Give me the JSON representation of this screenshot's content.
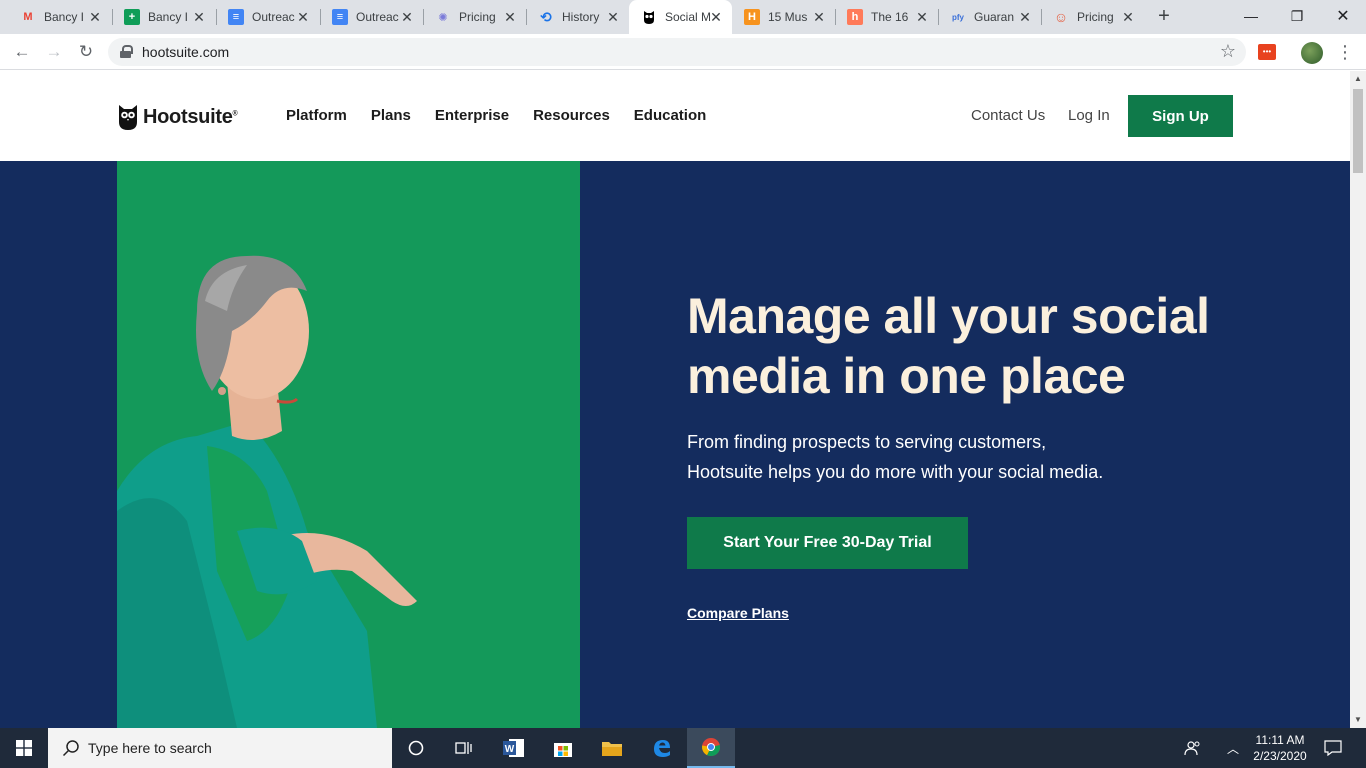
{
  "browser": {
    "tabs": [
      {
        "title": "Bancy I",
        "favicon": "gmail-icon",
        "fav_color": "#ea4335",
        "fav_glyph": "M"
      },
      {
        "title": "Bancy I",
        "favicon": "sheets-icon",
        "fav_color": "#0f9d58",
        "fav_glyph": "+"
      },
      {
        "title": "Outreac",
        "favicon": "docs-icon",
        "fav_color": "#4285f4",
        "fav_glyph": "≡"
      },
      {
        "title": "Outreac",
        "favicon": "docs-icon",
        "fav_color": "#4285f4",
        "fav_glyph": "≡"
      },
      {
        "title": "Pricing",
        "favicon": "sprout-icon",
        "fav_color": "#7b7bd9",
        "fav_glyph": "✺"
      },
      {
        "title": "History",
        "favicon": "history-icon",
        "fav_color": "#1a73e8",
        "fav_glyph": "⟲"
      },
      {
        "title": "Social M",
        "favicon": "hootsuite-owl-icon",
        "fav_color": "#000000",
        "fav_glyph": "◆"
      },
      {
        "title": "15 Mus",
        "favicon": "orange-h-icon",
        "fav_color": "#f7931e",
        "fav_glyph": "H"
      },
      {
        "title": "The 16",
        "favicon": "hubspot-icon",
        "fav_color": "#ff7a59",
        "fav_glyph": "h"
      },
      {
        "title": "Guaran",
        "favicon": "pfy-icon",
        "fav_color": "#3a6fd8",
        "fav_glyph": "pfy"
      },
      {
        "title": "Pricing",
        "favicon": "smiley-icon",
        "fav_color": "#e55e40",
        "fav_glyph": "☺"
      }
    ],
    "active_tab_index": 6,
    "url": "hootsuite.com"
  },
  "site": {
    "logo_text": "Hootsuite",
    "logo_mark": "®",
    "nav": [
      "Platform",
      "Plans",
      "Enterprise",
      "Resources",
      "Education"
    ],
    "contact": "Contact Us",
    "login": "Log In",
    "signup": "Sign Up"
  },
  "hero": {
    "headline": "Manage all your social media in one place",
    "sub_line1": "From finding prospects to serving customers,",
    "sub_line2": "Hootsuite helps you do more with your social media.",
    "cta": "Start Your Free 30-Day Trial",
    "compare": "Compare Plans"
  },
  "taskbar": {
    "search_placeholder": "Type here to search",
    "time": "11:11 AM",
    "date": "2/23/2020"
  },
  "colors": {
    "hero_bg": "#142c5e",
    "hero_green": "#13995a",
    "cta_green": "#0f7a4a",
    "headline_cream": "#fbf0dd"
  }
}
